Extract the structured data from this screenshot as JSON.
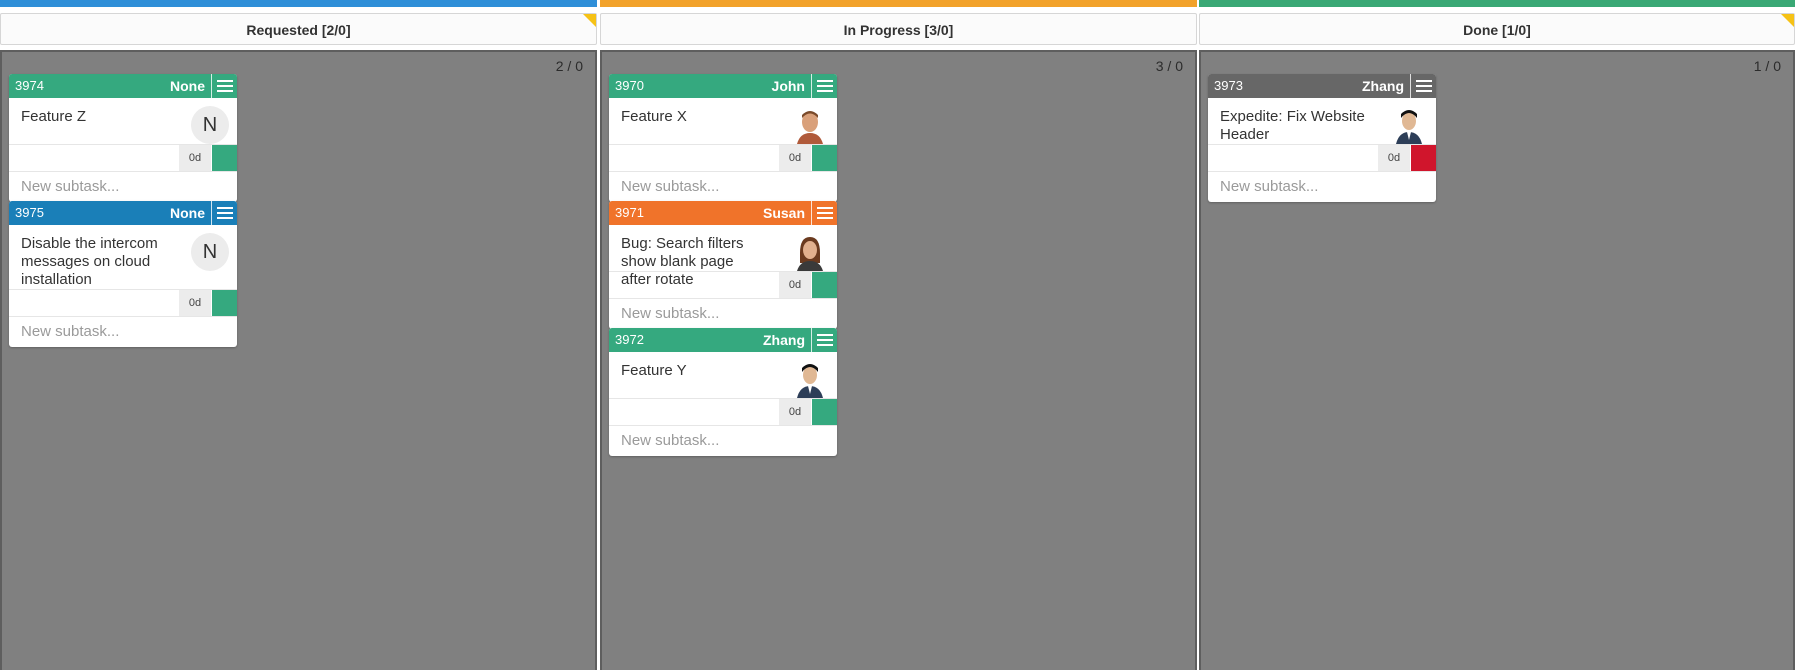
{
  "colors": {
    "requested_bar": "#2f8fd8",
    "inprogress_bar": "#f2a22a",
    "done_bar": "#3aa875",
    "green": "#35a97f",
    "blue": "#1a7fb8",
    "orange": "#f0732a",
    "gray_header": "#676767",
    "red": "#d0152c"
  },
  "columns": [
    {
      "title": "Requested [2/0]",
      "count": "2 / 0",
      "cards": [
        {
          "id": "3974",
          "owner": "None",
          "title": "Feature Z",
          "avatar_letter": "N",
          "estimate": "0d",
          "subtask_placeholder": "New subtask..."
        },
        {
          "id": "3975",
          "owner": "None",
          "title": "Disable the intercom messages on cloud installation",
          "avatar_letter": "N",
          "estimate": "0d",
          "subtask_placeholder": "New subtask..."
        }
      ]
    },
    {
      "title": "In Progress [3/0]",
      "count": "3 / 0",
      "cards": [
        {
          "id": "3970",
          "owner": "John",
          "title": "Feature X",
          "avatar": "john-photo",
          "estimate": "0d",
          "subtask_placeholder": "New subtask..."
        },
        {
          "id": "3971",
          "owner": "Susan",
          "title": "Bug: Search filters show blank page after rotate",
          "avatar": "susan-photo",
          "estimate": "0d",
          "subtask_placeholder": "New subtask..."
        },
        {
          "id": "3972",
          "owner": "Zhang",
          "title": "Feature Y",
          "avatar": "zhang-photo",
          "estimate": "0d",
          "subtask_placeholder": "New subtask..."
        }
      ]
    },
    {
      "title": "Done [1/0]",
      "count": "1 / 0",
      "cards": [
        {
          "id": "3973",
          "owner": "Zhang",
          "title": "Expedite: Fix Website Header",
          "avatar": "zhang-photo",
          "estimate": "0d",
          "subtask_placeholder": "New subtask..."
        }
      ]
    }
  ]
}
